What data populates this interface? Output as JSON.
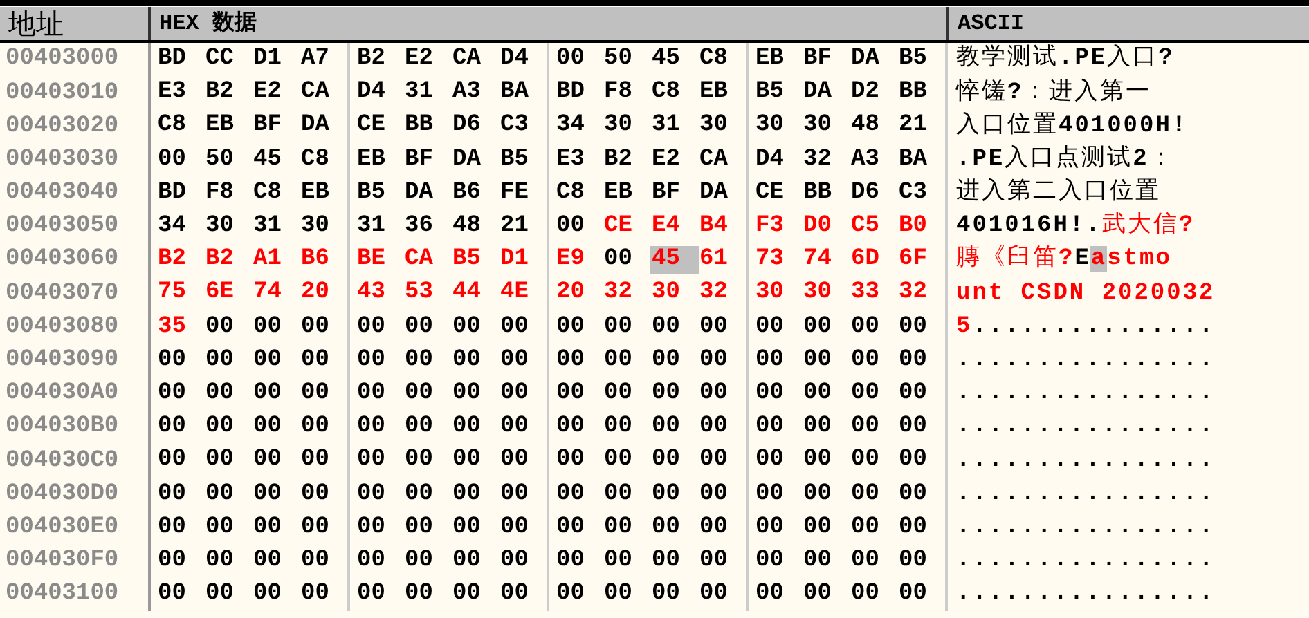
{
  "columns": [
    {
      "label": "地址"
    },
    {
      "label": "HEX 数据"
    },
    {
      "label": "ASCII"
    }
  ],
  "rows": [
    {
      "address": "00403000",
      "bytes": [
        {
          "values": [
            "BD",
            "CC",
            "D1",
            "A7",
            "B2",
            "E2",
            "CA",
            "D4",
            "00",
            "50",
            "45",
            "C8",
            "EB",
            "BF",
            "DA",
            "B5"
          ],
          "modified": false,
          "selected": false
        }
      ],
      "ascii": [
        {
          "text": "教学测试.PE入口?",
          "modified": false,
          "selected": false
        }
      ]
    },
    {
      "address": "00403010",
      "bytes": [
        {
          "values": [
            "E3",
            "B2",
            "E2",
            "CA",
            "D4",
            "31",
            "A3",
            "BA",
            "BD",
            "F8",
            "C8",
            "EB",
            "B5",
            "DA",
            "D2",
            "BB"
          ],
          "modified": false,
          "selected": false
        }
      ],
      "ascii": [
        {
          "text": "悴馐?：进入第一",
          "modified": false,
          "selected": false
        }
      ]
    },
    {
      "address": "00403020",
      "bytes": [
        {
          "values": [
            "C8",
            "EB",
            "BF",
            "DA",
            "CE",
            "BB",
            "D6",
            "C3",
            "34",
            "30",
            "31",
            "30",
            "30",
            "30",
            "48",
            "21"
          ],
          "modified": false,
          "selected": false
        }
      ],
      "ascii": [
        {
          "text": "入口位置401000H!",
          "modified": false,
          "selected": false
        }
      ]
    },
    {
      "address": "00403030",
      "bytes": [
        {
          "values": [
            "00",
            "50",
            "45",
            "C8",
            "EB",
            "BF",
            "DA",
            "B5",
            "E3",
            "B2",
            "E2",
            "CA",
            "D4",
            "32",
            "A3",
            "BA"
          ],
          "modified": false,
          "selected": false
        }
      ],
      "ascii": [
        {
          "text": ".PE入口点测试2：",
          "modified": false,
          "selected": false
        }
      ]
    },
    {
      "address": "00403040",
      "bytes": [
        {
          "values": [
            "BD",
            "F8",
            "C8",
            "EB",
            "B5",
            "DA",
            "B6",
            "FE",
            "C8",
            "EB",
            "BF",
            "DA",
            "CE",
            "BB",
            "D6",
            "C3"
          ],
          "modified": false,
          "selected": false
        }
      ],
      "ascii": [
        {
          "text": "进入第二入口位置",
          "modified": false,
          "selected": false
        }
      ]
    },
    {
      "address": "00403050",
      "bytes": [
        {
          "values": [
            "34",
            "30",
            "31",
            "30",
            "31",
            "36",
            "48",
            "21",
            "00"
          ],
          "modified": false,
          "selected": false
        },
        {
          "values": [
            "CE",
            "E4",
            "B4",
            "F3",
            "D0",
            "C5",
            "B0"
          ],
          "modified": true,
          "selected": false
        }
      ],
      "ascii": [
        {
          "text": "401016H!.",
          "modified": false,
          "selected": false
        },
        {
          "text": "武大信?",
          "modified": true,
          "selected": false
        }
      ]
    },
    {
      "address": "00403060",
      "bytes": [
        {
          "values": [
            "B2",
            "B2",
            "A1",
            "B6",
            "BE",
            "CA",
            "B5",
            "D1",
            "E9"
          ],
          "modified": true,
          "selected": false
        },
        {
          "values": [
            "00"
          ],
          "modified": false,
          "selected": false
        },
        {
          "values": [
            "45"
          ],
          "modified": true,
          "selected": true
        },
        {
          "values": [
            "61",
            "73",
            "74",
            "6D",
            "6F"
          ],
          "modified": true,
          "selected": false
        }
      ],
      "ascii": [
        {
          "text": "膞《臼笛?",
          "modified": true,
          "selected": false
        },
        {
          "text": "E",
          "modified": false,
          "selected": false
        },
        {
          "text": "a",
          "modified": true,
          "selected": true
        },
        {
          "text": "stmo",
          "modified": true,
          "selected": false
        }
      ]
    },
    {
      "address": "00403070",
      "bytes": [
        {
          "values": [
            "75",
            "6E",
            "74",
            "20",
            "43",
            "53",
            "44",
            "4E",
            "20",
            "32",
            "30",
            "32",
            "30",
            "30",
            "33",
            "32"
          ],
          "modified": true,
          "selected": false
        }
      ],
      "ascii": [
        {
          "text": "unt CSDN 2020032",
          "modified": true,
          "selected": false
        }
      ]
    },
    {
      "address": "00403080",
      "bytes": [
        {
          "values": [
            "35"
          ],
          "modified": true,
          "selected": false
        },
        {
          "values": [
            "00",
            "00",
            "00",
            "00",
            "00",
            "00",
            "00",
            "00",
            "00",
            "00",
            "00",
            "00",
            "00",
            "00",
            "00"
          ],
          "modified": false,
          "selected": false
        }
      ],
      "ascii": [
        {
          "text": "5",
          "modified": true,
          "selected": false
        },
        {
          "text": "...............",
          "modified": false,
          "selected": false
        }
      ]
    },
    {
      "address": "00403090",
      "bytes": [
        {
          "values": [
            "00",
            "00",
            "00",
            "00",
            "00",
            "00",
            "00",
            "00",
            "00",
            "00",
            "00",
            "00",
            "00",
            "00",
            "00",
            "00"
          ],
          "modified": false,
          "selected": false
        }
      ],
      "ascii": [
        {
          "text": "................",
          "modified": false,
          "selected": false
        }
      ]
    },
    {
      "address": "004030A0",
      "bytes": [
        {
          "values": [
            "00",
            "00",
            "00",
            "00",
            "00",
            "00",
            "00",
            "00",
            "00",
            "00",
            "00",
            "00",
            "00",
            "00",
            "00",
            "00"
          ],
          "modified": false,
          "selected": false
        }
      ],
      "ascii": [
        {
          "text": "................",
          "modified": false,
          "selected": false
        }
      ]
    },
    {
      "address": "004030B0",
      "bytes": [
        {
          "values": [
            "00",
            "00",
            "00",
            "00",
            "00",
            "00",
            "00",
            "00",
            "00",
            "00",
            "00",
            "00",
            "00",
            "00",
            "00",
            "00"
          ],
          "modified": false,
          "selected": false
        }
      ],
      "ascii": [
        {
          "text": "................",
          "modified": false,
          "selected": false
        }
      ]
    },
    {
      "address": "004030C0",
      "bytes": [
        {
          "values": [
            "00",
            "00",
            "00",
            "00",
            "00",
            "00",
            "00",
            "00",
            "00",
            "00",
            "00",
            "00",
            "00",
            "00",
            "00",
            "00"
          ],
          "modified": false,
          "selected": false
        }
      ],
      "ascii": [
        {
          "text": "................",
          "modified": false,
          "selected": false
        }
      ]
    },
    {
      "address": "004030D0",
      "bytes": [
        {
          "values": [
            "00",
            "00",
            "00",
            "00",
            "00",
            "00",
            "00",
            "00",
            "00",
            "00",
            "00",
            "00",
            "00",
            "00",
            "00",
            "00"
          ],
          "modified": false,
          "selected": false
        }
      ],
      "ascii": [
        {
          "text": "................",
          "modified": false,
          "selected": false
        }
      ]
    },
    {
      "address": "004030E0",
      "bytes": [
        {
          "values": [
            "00",
            "00",
            "00",
            "00",
            "00",
            "00",
            "00",
            "00",
            "00",
            "00",
            "00",
            "00",
            "00",
            "00",
            "00",
            "00"
          ],
          "modified": false,
          "selected": false
        }
      ],
      "ascii": [
        {
          "text": "................",
          "modified": false,
          "selected": false
        }
      ]
    },
    {
      "address": "004030F0",
      "bytes": [
        {
          "values": [
            "00",
            "00",
            "00",
            "00",
            "00",
            "00",
            "00",
            "00",
            "00",
            "00",
            "00",
            "00",
            "00",
            "00",
            "00",
            "00"
          ],
          "modified": false,
          "selected": false
        }
      ],
      "ascii": [
        {
          "text": "................",
          "modified": false,
          "selected": false
        }
      ]
    },
    {
      "address": "00403100",
      "bytes": [
        {
          "values": [
            "00",
            "00",
            "00",
            "00",
            "00",
            "00",
            "00",
            "00",
            "00",
            "00",
            "00",
            "00",
            "00",
            "00",
            "00",
            "00"
          ],
          "modified": false,
          "selected": false
        }
      ],
      "ascii": [
        {
          "text": "................",
          "modified": false,
          "selected": false
        }
      ]
    }
  ]
}
